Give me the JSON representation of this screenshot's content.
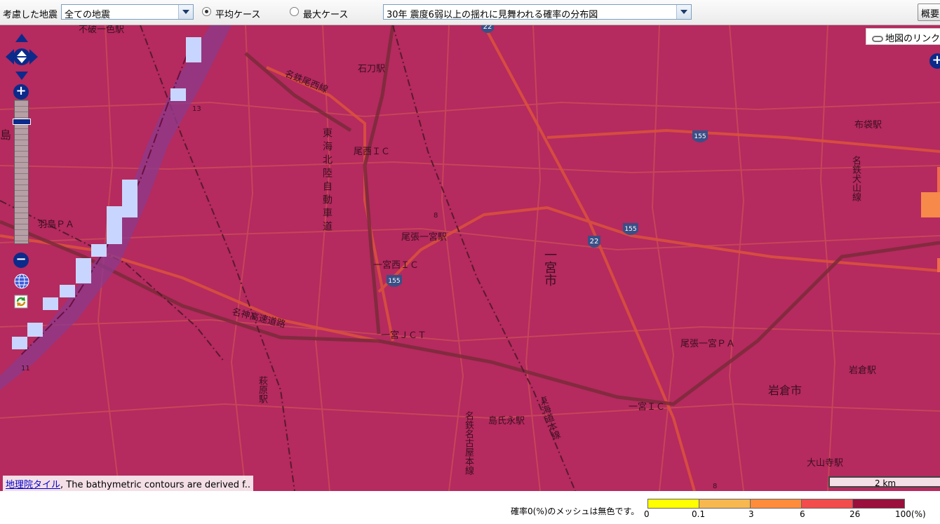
{
  "toolbar": {
    "earthquake_label": "考慮した地震",
    "earthquake_select_value": "全ての地震",
    "case_average_label": "平均ケース",
    "case_max_label": "最大ケース",
    "case_selected": "average",
    "map_type_select_value": "30年 震度6弱以上の揺れに見舞われる確率の分布図",
    "overview_button": "概要"
  },
  "map": {
    "link_button": "地図のリンク",
    "attribution_link": "地理院タイル",
    "attribution_rest": ", The bathymetric contours are derived f..",
    "scale_label": "2 km",
    "overlay_color": "#b52a5f",
    "labels": {
      "fudo": "不破一色駅",
      "ishikiri": "石刀駅",
      "meitetsu_bisai": "名鉄尾西線",
      "tokai_hokuriku": "東海北陸自動車道",
      "bisai_ic": "尾西ＩＣ",
      "hashima_pa": "羽島ＰＡ",
      "owari_ichinomiya": "尾張一宮駅",
      "ichinomiya_nishi_ic": "一宮西ＩＣ",
      "ichinomiya_city": "一宮市",
      "meishin": "名神高速道路",
      "ichinomiya_jct": "一宮ＪＣＴ",
      "hagiwara": "萩原駅",
      "shimauji": "島氏永駅",
      "meitetsu_nagoya": "名鉄名古屋本線",
      "tokaido": "東海道本線",
      "ichinomiya_ic": "一宮ＩＣ",
      "owari_ichinomiya_pa": "尾張一宮ＰＡ",
      "iwakura": "岩倉駅",
      "iwakura_city": "岩倉市",
      "ooyamadera": "大山寺駅",
      "fukuro": "布袋駅",
      "meitetsu_inuyama": "名鉄犬山線",
      "route22_a": "22",
      "route22_b": "22",
      "route155_a": "155",
      "route155_b": "155",
      "route155_c": "155",
      "tri13": "13",
      "tri11": "11",
      "tri8a": "8",
      "tri8b": "8",
      "left_edge": "島"
    }
  },
  "legend": {
    "note": "確率0(%)のメッシュは無色です。",
    "ticks": [
      "0",
      "0.1",
      "3",
      "6",
      "26",
      "100(%)"
    ],
    "colors": [
      "#ffff00",
      "#f7b84f",
      "#ff8c3a",
      "#f24c4c",
      "#9a0f3c"
    ]
  }
}
